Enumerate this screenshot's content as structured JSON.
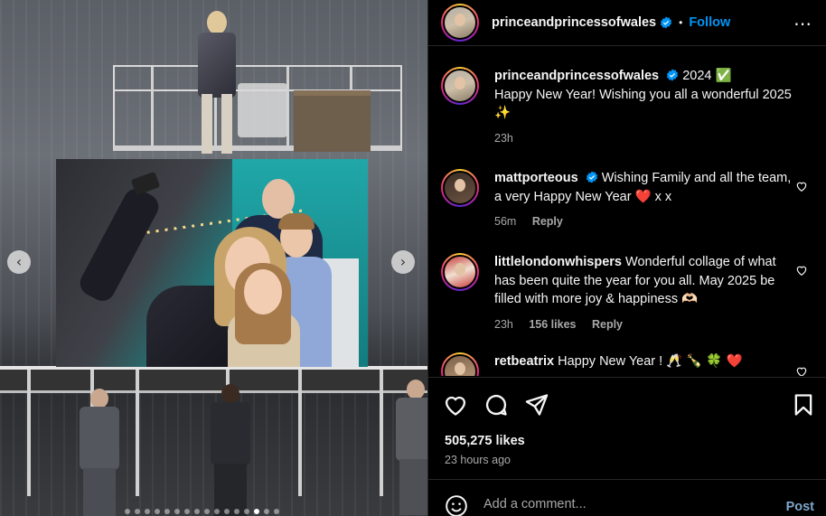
{
  "carousel": {
    "prev_arrow": "‹",
    "next_arrow": "›",
    "dot_count": 16,
    "active_dot_index": 13
  },
  "header": {
    "username": "princeandprincessofwales",
    "separator": "•",
    "follow_label": "Follow",
    "more_icon": "⋯"
  },
  "caption": {
    "username": "princeandprincessofwales",
    "text_line1_suffix": "2024",
    "text_line1_emoji": "✅",
    "text": "Happy New Year! Wishing you all a wonderful 2025",
    "text_emoji": "✨",
    "time": "23h"
  },
  "comments": [
    {
      "username": "mattporteous",
      "verified": true,
      "text": "Wishing Family and all the team, a very Happy New Year",
      "emoji": "❤️",
      "suffix": "x x",
      "time": "56m",
      "likes": "",
      "reply_label": "Reply"
    },
    {
      "username": "littlelondonwhispers",
      "verified": false,
      "text": "Wonderful collage of what has been quite the year for you all. May 2025 be filled with more joy & happiness",
      "emoji": "🫶🏻",
      "suffix": "",
      "time": "23h",
      "likes": "156 likes",
      "reply_label": "Reply"
    },
    {
      "username": "retbeatrix",
      "verified": false,
      "text": "Happy New Year !",
      "emoji": "🥂 🍾 🍀 ❤️",
      "suffix": "",
      "time": "",
      "likes": "",
      "reply_label": ""
    }
  ],
  "actions": {
    "likes": "505,275 likes",
    "time_ago": "23 hours ago"
  },
  "add_comment": {
    "placeholder": "Add a comment...",
    "post_label": "Post"
  },
  "colors": {
    "accent": "#0095f6",
    "verified": "#0095f6",
    "post_disabled": "#7fa7c9",
    "heart_red": "#ff3040",
    "check_green": "#2ecc40"
  }
}
